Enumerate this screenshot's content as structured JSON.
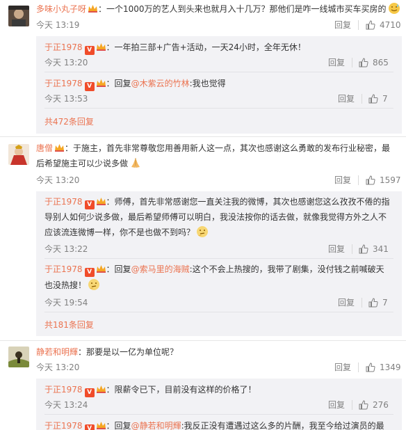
{
  "threads": [
    {
      "user": "多味小丸子呀",
      "text": "：一个1000万的艺人到头来也就月入十几万？那他们是咋一线城市买车买房的",
      "time": "今天 13:19",
      "reply_label": "回复",
      "likes": "4710",
      "replies": [
        {
          "user": "于正1978",
          "text": "：一年拍三部+广告+活动，一天24小时，全年无休！",
          "time": "今天 13:20",
          "reply_label": "回复",
          "likes": "865"
        },
        {
          "user": "于正1978",
          "prefix": "：回复",
          "mention": "@木紫云的竹林",
          "text": ":我也觉得",
          "time": "今天 13:53",
          "reply_label": "回复",
          "likes": "7"
        }
      ],
      "more": "共472条回复"
    },
    {
      "user": "唐僧",
      "text_line1": "：于施主，首先非常尊敬您用善用新人这一点，其次也感谢这么勇敢的发布行业秘密，最",
      "text_line2": "后希望施主可以少说多做",
      "time": "今天 13:20",
      "reply_label": "回复",
      "likes": "1597",
      "replies": [
        {
          "user": "于正1978",
          "text_line1": "：师傅，首先非常感谢您一直关注我的微博，其次也感谢您这么孜孜不倦的指",
          "text_line2": "导别人如何少说多做，最后希望师傅可以明白，我没法按你的话去做，就像我觉得方外之人不",
          "text_line3": "应该流连微博一样，你不是也做不到吗？",
          "time": "今天 13:22",
          "reply_label": "回复",
          "likes": "341"
        },
        {
          "user": "于正1978",
          "prefix": "：回复",
          "mention": "@索马里的海贼",
          "text_line1": ":这个不会上热搜的，我带了剧集，没付钱之前喊破天",
          "text_line2": "也没热搜！",
          "time": "今天 19:54",
          "reply_label": "回复",
          "likes": "7"
        }
      ],
      "more": "共181条回复"
    },
    {
      "user": "静若和明輝",
      "text": "：那要是以一亿为单位呢？",
      "time": "今天 13:20",
      "reply_label": "回复",
      "likes": "1349",
      "replies": [
        {
          "user": "于正1978",
          "text": "：限薪令已下，目前没有这样的价格了！",
          "time": "今天 13:24",
          "reply_label": "回复",
          "likes": "276"
        },
        {
          "user": "于正1978",
          "prefix": "：回复",
          "mention": "@静若和明輝",
          "text": ":我反正没有遭遇过这么多的片酬，我至今给过演员的最"
        }
      ]
    }
  ],
  "colors": {
    "accent": "#eb7350",
    "meta": "#808080",
    "reply_bg": "#f2f2f5",
    "vip": "#f04c2a"
  },
  "icons": {
    "like": "thumbs-up-icon",
    "vip_badge": "v-badge-icon",
    "crown": "crown-badge-icon",
    "emoji_sweat": "sweat-smile-emoji",
    "emoji_pray": "pray-emoji",
    "emoji_think": "thinking-emoji"
  }
}
